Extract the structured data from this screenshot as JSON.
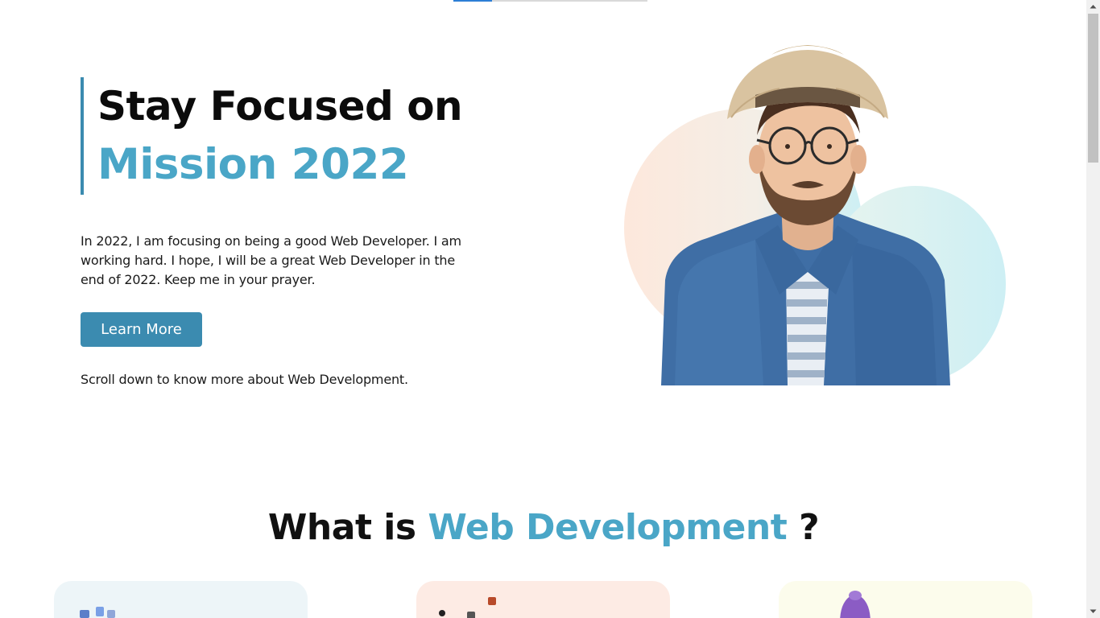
{
  "hero": {
    "title_line1": "Stay Focused on",
    "title_line2": "Mission 2022",
    "paragraph": "In 2022, I am focusing on being a good Web Developer. I am working hard. I hope, I will be a great Web Developer in the end of 2022. Keep me in your prayer.",
    "button_label": "Learn More",
    "scroll_note": "Scroll down to know more about Web Development."
  },
  "section": {
    "title_prefix": "What is ",
    "title_accent": "Web Development",
    "title_suffix": " ?"
  },
  "colors": {
    "accent": "#4aa6c7",
    "button": "#3b8bb0",
    "card1": "#edf5f8",
    "card2": "#fdebe4",
    "card3": "#fcfcec"
  },
  "icons": {
    "hero_image": "person-with-hat-photo"
  }
}
